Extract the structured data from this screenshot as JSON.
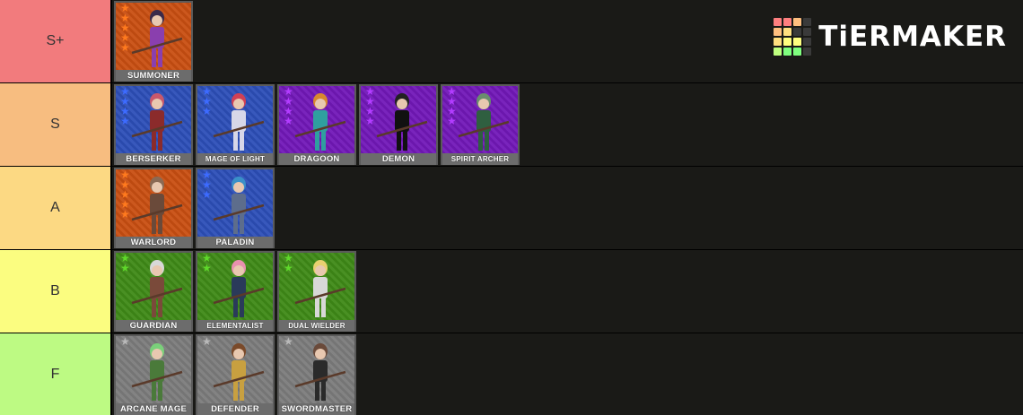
{
  "logo": {
    "text": "TiERMAKER"
  },
  "tiers": [
    {
      "label": "S+",
      "color": "#f27b7d",
      "items": [
        {
          "name": "SUMMONER",
          "bg": "orange",
          "stars": 5
        }
      ]
    },
    {
      "label": "S",
      "color": "#f7bd80",
      "items": [
        {
          "name": "BERSERKER",
          "bg": "blue",
          "stars": 4
        },
        {
          "name": "MAGE OF LIGHT",
          "bg": "blue",
          "stars": 3
        },
        {
          "name": "DRAGOON",
          "bg": "purple",
          "stars": 4
        },
        {
          "name": "DEMON",
          "bg": "purple",
          "stars": 4
        },
        {
          "name": "SPIRIT ARCHER",
          "bg": "purple",
          "stars": 4
        }
      ]
    },
    {
      "label": "A",
      "color": "#fcd983",
      "items": [
        {
          "name": "WARLORD",
          "bg": "orange",
          "stars": 5
        },
        {
          "name": "PALADIN",
          "bg": "blue",
          "stars": 3
        }
      ]
    },
    {
      "label": "B",
      "color": "#fbfd80",
      "items": [
        {
          "name": "GUARDIAN",
          "bg": "green",
          "stars": 2
        },
        {
          "name": "ELEMENTALIST",
          "bg": "green",
          "stars": 2
        },
        {
          "name": "DUAL WIELDER",
          "bg": "green",
          "stars": 2
        }
      ]
    },
    {
      "label": "F",
      "color": "#bdfa83",
      "items": [
        {
          "name": "ARCANE MAGE",
          "bg": "gray",
          "stars": 1
        },
        {
          "name": "DEFENDER",
          "bg": "gray",
          "stars": 1
        },
        {
          "name": "SWORDMASTER",
          "bg": "gray",
          "stars": 1
        }
      ]
    }
  ],
  "colors": {
    "orange": "#c94f12",
    "blue": "#2d4fb8",
    "purple": "#7218b8",
    "green": "#3f8a17",
    "gray": "#7c7c7c",
    "star_orange": "#ff7a1e",
    "star_blue": "#3d6bff",
    "star_purple": "#b23cff",
    "star_green": "#5fd82a",
    "star_gray": "#b9b9b9"
  }
}
